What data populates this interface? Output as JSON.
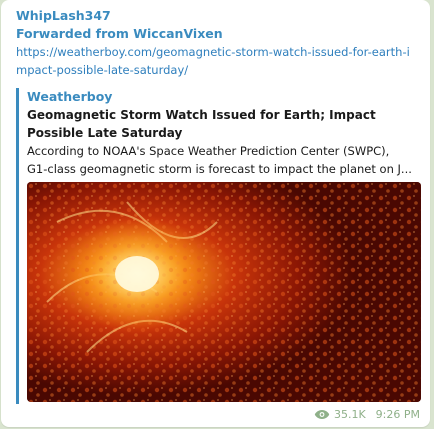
{
  "message": {
    "sender": "WhipLash347",
    "forwarded_from": "Forwarded from WiccanVixen",
    "link": "https://weatherboy.com/geomagnetic-storm-watch-issued-for-earth-impact-possible-late-saturday/",
    "preview": {
      "site_name": "Weatherboy",
      "title": "Geomagnetic Storm Watch Issued for Earth; Impact Possible Late Saturday",
      "description_line1": "According to NOAA's Space Weather Prediction Center (SWPC),",
      "description_line2": "G1-class geomagnetic storm is forecast to impact the planet on J..."
    },
    "views": "35.1K",
    "time": "9:26 PM"
  },
  "colors": {
    "accent": "#3a8bbf",
    "link": "#2f7fbd",
    "meta": "#8fb089",
    "chat_background": "#d9e4cf"
  },
  "icons": {
    "views": "eye-icon"
  }
}
